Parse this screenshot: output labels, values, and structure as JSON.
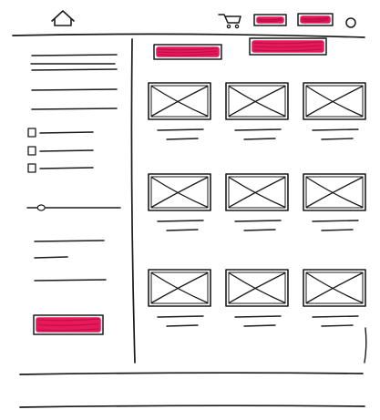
{
  "header": {
    "home_icon": "home-icon",
    "cart_icon": "shopping-cart-icon",
    "buttons": [
      "red-placeholder-button",
      "red-placeholder-button"
    ],
    "account_icon": "circle-icon"
  },
  "sidebar": {
    "link_lines": 4,
    "checkbox_options": 3,
    "range_slider_value": 0.1,
    "extra_lines": 3,
    "cta_button": "red-placeholder-button"
  },
  "main": {
    "action_buttons": [
      "red-placeholder-button",
      "red-placeholder-button"
    ],
    "product_grid": {
      "rows": 3,
      "columns": 3,
      "image_icon": "image-placeholder-icon"
    }
  },
  "footer": {
    "lines": 2
  },
  "colors": {
    "ink": "#1a1a1a",
    "accent": "#e8195a",
    "paper": "#ffffff"
  }
}
